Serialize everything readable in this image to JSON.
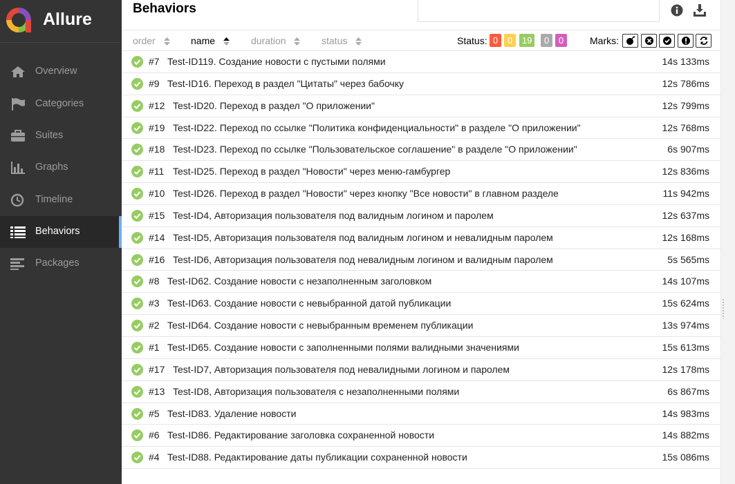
{
  "app": {
    "title": "Allure"
  },
  "sidebar": {
    "items": [
      {
        "label": "Overview",
        "icon": "home-icon"
      },
      {
        "label": "Categories",
        "icon": "flag-icon"
      },
      {
        "label": "Suites",
        "icon": "briefcase-icon"
      },
      {
        "label": "Graphs",
        "icon": "bar-chart-icon"
      },
      {
        "label": "Timeline",
        "icon": "clock-icon"
      },
      {
        "label": "Behaviors",
        "icon": "list-icon",
        "active": true
      },
      {
        "label": "Packages",
        "icon": "align-left-icon"
      }
    ]
  },
  "header": {
    "title": "Behaviors",
    "search_value": "",
    "search_placeholder": ""
  },
  "sort": {
    "order": "order",
    "name": "name",
    "duration": "duration",
    "status": "status"
  },
  "status_filter": {
    "label": "Status:",
    "counts": [
      {
        "value": "0",
        "color": "#fd5a3e",
        "name": "failed"
      },
      {
        "value": "0",
        "color": "#ffd050",
        "name": "broken"
      },
      {
        "value": "19",
        "color": "#97cc64",
        "name": "passed"
      },
      {
        "value": "0",
        "color": "#aaaaaa",
        "name": "skipped"
      },
      {
        "value": "0",
        "color": "#d35ebe",
        "name": "unknown"
      }
    ]
  },
  "marks": {
    "label": "Marks:",
    "icons": [
      "flaky-icon",
      "new-failed-icon",
      "new-passed-icon",
      "new-broken-icon",
      "retries-icon"
    ]
  },
  "tests": [
    {
      "num": "#7",
      "name": "Test-ID119. Создание новости с пустыми полями",
      "duration": "14s 133ms"
    },
    {
      "num": "#9",
      "name": "Test-ID16. Переход в раздел \"Цитаты\" через бабочку",
      "duration": "12s 786ms"
    },
    {
      "num": "#12",
      "name": "Test-ID20. Переход в раздел \"О приложении\"",
      "duration": "12s 799ms"
    },
    {
      "num": "#19",
      "name": "Test-ID22. Переход по ссылке \"Политика конфиденциальности\" в разделе \"О приложении\"",
      "duration": "12s 768ms"
    },
    {
      "num": "#18",
      "name": "Test-ID23. Переход по ссылке \"Пользовательское соглашение\" в разделе \"О приложении\"",
      "duration": "6s 907ms"
    },
    {
      "num": "#11",
      "name": "Test-ID25. Переход в раздел \"Новости\" через меню-гамбургер",
      "duration": "12s 836ms"
    },
    {
      "num": "#10",
      "name": "Test-ID26. Переход в раздел \"Новости\" через кнопку \"Все новости\" в главном разделе",
      "duration": "11s 942ms"
    },
    {
      "num": "#15",
      "name": "Test-ID4, Авторизация пользователя под валидным логином и паролем",
      "duration": "12s 637ms"
    },
    {
      "num": "#14",
      "name": "Test-ID5, Авторизация пользователя под валидным логином и невалидным паролем",
      "duration": "12s 168ms"
    },
    {
      "num": "#16",
      "name": "Test-ID6, Авторизация пользователя под невалидным логином и валидным паролем",
      "duration": "5s 565ms"
    },
    {
      "num": "#8",
      "name": "Test-ID62. Создание новости с незаполненным заголовком",
      "duration": "14s 107ms"
    },
    {
      "num": "#3",
      "name": "Test-ID63. Создание новости с невыбранной датой публикации",
      "duration": "15s 624ms"
    },
    {
      "num": "#2",
      "name": "Test-ID64. Создание новости с невыбранным временем публикации",
      "duration": "13s 974ms"
    },
    {
      "num": "#1",
      "name": "Test-ID65. Создание новости с заполненными полями валидными значениями",
      "duration": "15s 613ms"
    },
    {
      "num": "#17",
      "name": "Test-ID7, Авторизация пользователя под невалидными логином и паролем",
      "duration": "12s 178ms"
    },
    {
      "num": "#13",
      "name": "Test-ID8, Авторизация пользователя с незаполненными полями",
      "duration": "6s 867ms"
    },
    {
      "num": "#5",
      "name": "Test-ID83. Удаление новости",
      "duration": "14s 983ms"
    },
    {
      "num": "#6",
      "name": "Test-ID86. Редактирование заголовка сохраненной новости",
      "duration": "14s 882ms"
    },
    {
      "num": "#4",
      "name": "Test-ID88. Редактирование даты публикации сохраненной новости",
      "duration": "15s 086ms"
    }
  ],
  "colors": {
    "sidebar_bg": "#343434",
    "accent": "#6ab2f0",
    "passed": "#97cc64"
  }
}
